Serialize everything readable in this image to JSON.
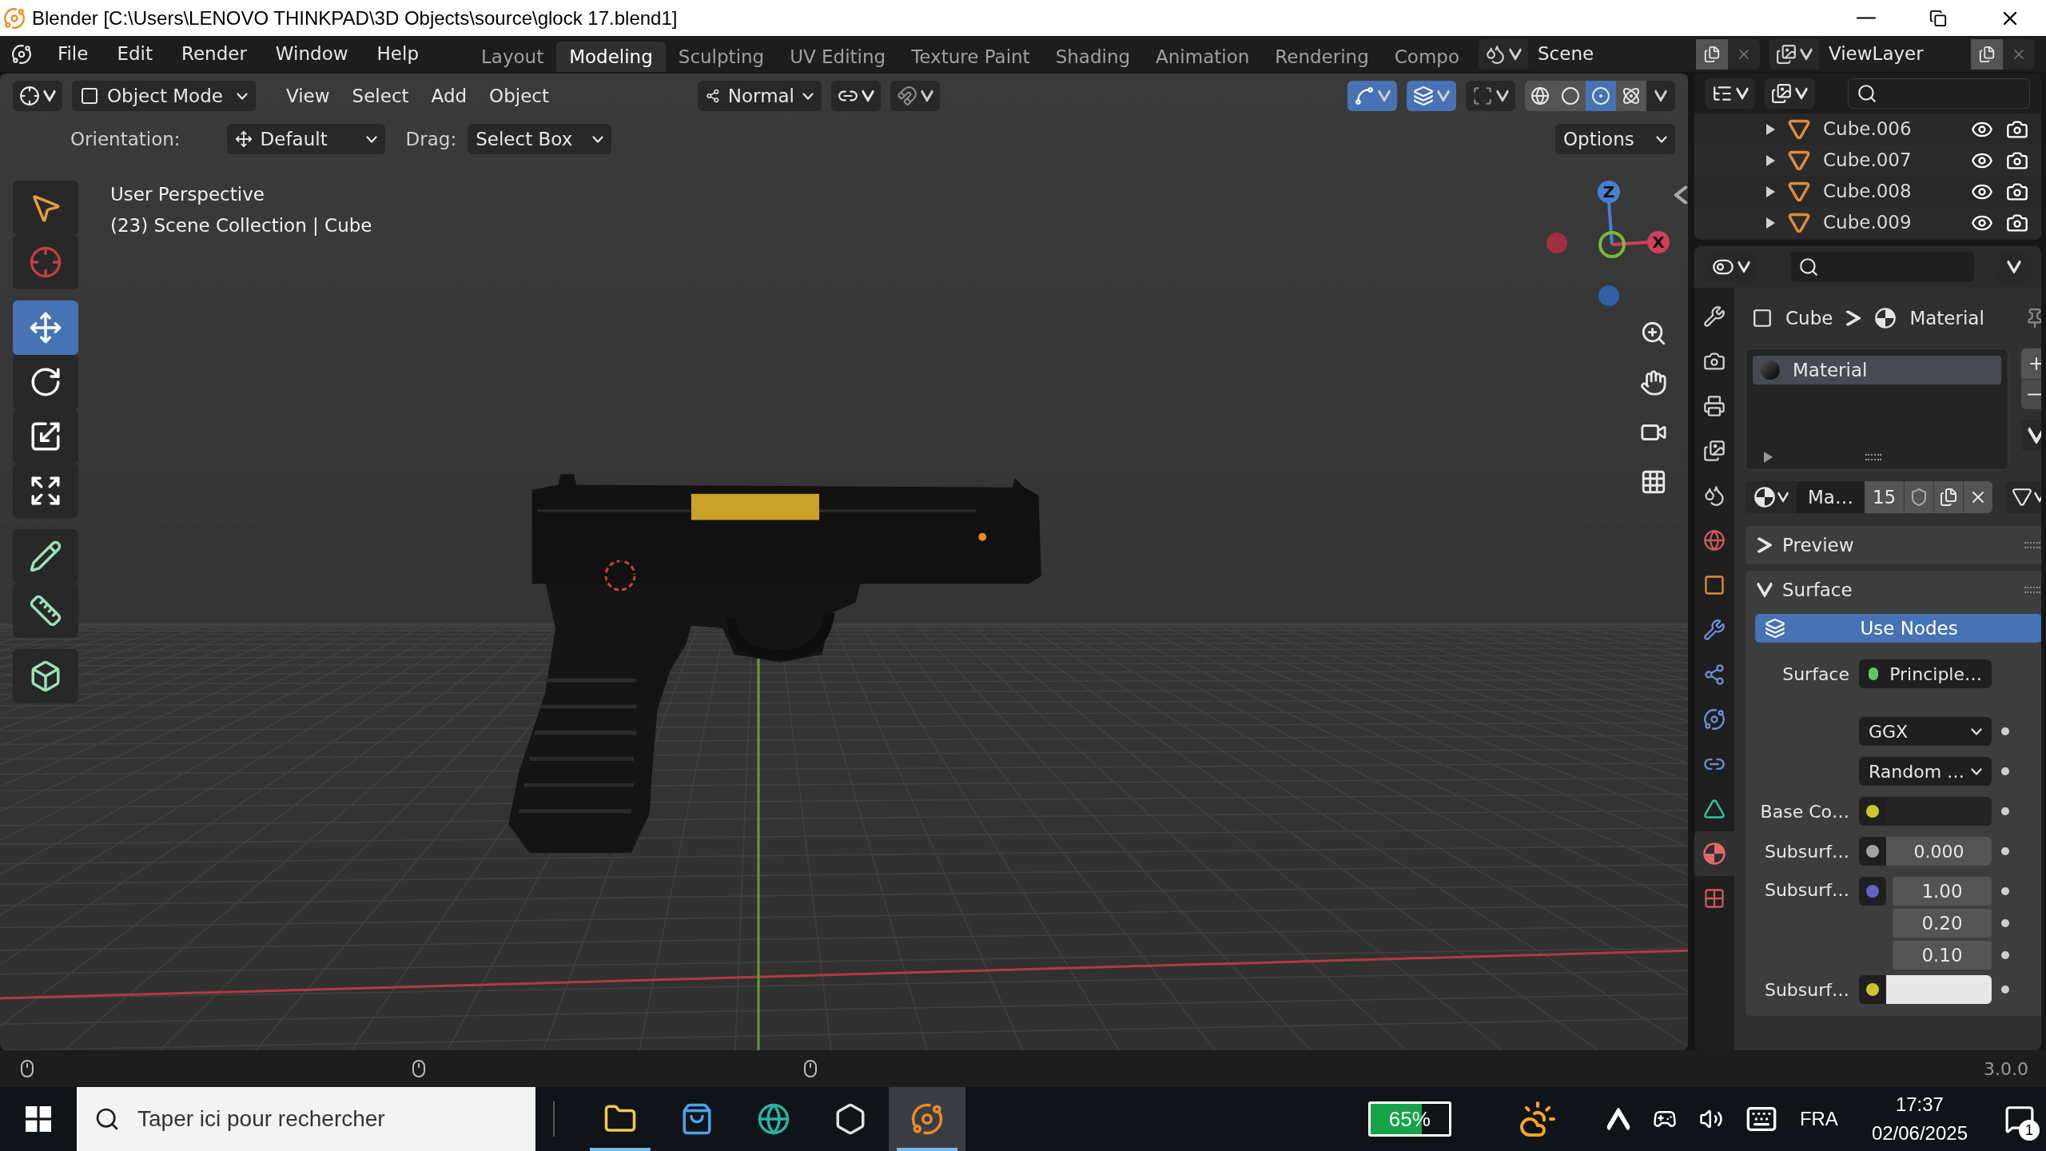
{
  "window": {
    "title": "Blender [C:\\Users\\LENOVO THINKPAD\\3D Objects\\source\\glock 17.blend1]"
  },
  "menu": [
    "File",
    "Edit",
    "Render",
    "Window",
    "Help"
  ],
  "workspaces": [
    {
      "label": "Layout",
      "selected": false
    },
    {
      "label": "Modeling",
      "selected": true
    },
    {
      "label": "Sculpting",
      "selected": false
    },
    {
      "label": "UV Editing",
      "selected": false
    },
    {
      "label": "Texture Paint",
      "selected": false
    },
    {
      "label": "Shading",
      "selected": false
    },
    {
      "label": "Animation",
      "selected": false
    },
    {
      "label": "Rendering",
      "selected": false
    },
    {
      "label": "Compo",
      "selected": false
    }
  ],
  "scene": {
    "name": "Scene"
  },
  "view_layer": {
    "name": "ViewLayer"
  },
  "viewport": {
    "mode": "Object Mode",
    "menus": [
      "View",
      "Select",
      "Add",
      "Object"
    ],
    "orientation": "Normal",
    "toggles": [
      {
        "kind": "snap",
        "on": false
      },
      {
        "kind": "gizmos",
        "on": true
      },
      {
        "kind": "overlays",
        "on": true
      },
      {
        "kind": "xray",
        "on": false
      }
    ],
    "shading": [
      {
        "kind": "wireframe",
        "selected": false
      },
      {
        "kind": "solid",
        "selected": false
      },
      {
        "kind": "material",
        "selected": true
      },
      {
        "kind": "rendered",
        "selected": false
      }
    ],
    "tool_settings": {
      "orientation_label": "Orientation:",
      "orientation": "Default",
      "drag_label": "Drag:",
      "drag": "Select Box",
      "options": "Options"
    },
    "info": [
      "User Perspective",
      "(23) Scene Collection | Cube"
    ],
    "tools": [
      {
        "kind": "select",
        "selected": false
      },
      {
        "kind": "cursor",
        "selected": false
      },
      {
        "kind": "move",
        "selected": true
      },
      {
        "kind": "rotate",
        "selected": false
      },
      {
        "kind": "scale",
        "selected": false
      },
      {
        "kind": "transform",
        "selected": false
      },
      {
        "kind": "annotate",
        "selected": false
      },
      {
        "kind": "measure",
        "selected": false
      },
      {
        "kind": "add_cube",
        "selected": false
      }
    ],
    "gizmo": {
      "z": "Z",
      "x": "X"
    }
  },
  "outliner": {
    "items": [
      {
        "name": "Cube.006"
      },
      {
        "name": "Cube.007"
      },
      {
        "name": "Cube.008"
      },
      {
        "name": "Cube.009"
      }
    ]
  },
  "properties": {
    "tabs": [
      {
        "kind": "tool",
        "selected": false
      },
      {
        "kind": "render",
        "selected": false
      },
      {
        "kind": "output",
        "selected": false
      },
      {
        "kind": "view_layer",
        "selected": false
      },
      {
        "kind": "scene",
        "selected": false
      },
      {
        "kind": "world",
        "selected": false
      },
      {
        "kind": "object",
        "selected": false
      },
      {
        "kind": "modifiers",
        "selected": false
      },
      {
        "kind": "particles",
        "selected": false
      },
      {
        "kind": "physics",
        "selected": false
      },
      {
        "kind": "constraints",
        "selected": false
      },
      {
        "kind": "data",
        "selected": false
      },
      {
        "kind": "material",
        "selected": true
      },
      {
        "kind": "texture",
        "selected": false
      }
    ],
    "breadcrumb": {
      "object": "Cube",
      "material": "Material"
    },
    "slots": [
      {
        "name": "Material",
        "selected": true
      }
    ],
    "datablock": {
      "name": "Ma…",
      "users": "15"
    },
    "panels": [
      {
        "title": "Preview",
        "expanded": false
      },
      {
        "title": "Surface",
        "expanded": true
      }
    ],
    "use_nodes": "Use Nodes",
    "rows": [
      {
        "kind": "shader",
        "label": "Surface",
        "value": "Principle…"
      },
      {
        "kind": "enum",
        "value": "GGX"
      },
      {
        "kind": "enum",
        "value": "Random …"
      },
      {
        "kind": "color",
        "label": "Base Co…",
        "color": "#242424"
      },
      {
        "kind": "value",
        "label": "Subsurf…",
        "value": "0.000"
      },
      {
        "kind": "vector",
        "label": "Subsurf…",
        "values": [
          "1.00",
          "0.20",
          "0.10"
        ]
      },
      {
        "kind": "color",
        "label": "Subsurf…",
        "color": "#e8e8e8"
      }
    ]
  },
  "status_bar": {
    "version": "3.0.0"
  },
  "taskbar": {
    "search_placeholder": "Taper ici pour rechercher",
    "apps": [
      {
        "kind": "explorer",
        "running": true,
        "active": false
      },
      {
        "kind": "store",
        "running": false,
        "active": false
      },
      {
        "kind": "edge",
        "running": false,
        "active": false
      },
      {
        "kind": "unity",
        "running": false,
        "active": false
      },
      {
        "kind": "blender",
        "running": true,
        "active": true
      }
    ],
    "battery": {
      "reading": "65%",
      "level": 0.65
    },
    "language": "FRA",
    "time": "17:37",
    "date": "02/06/2025",
    "notifications": "1"
  }
}
